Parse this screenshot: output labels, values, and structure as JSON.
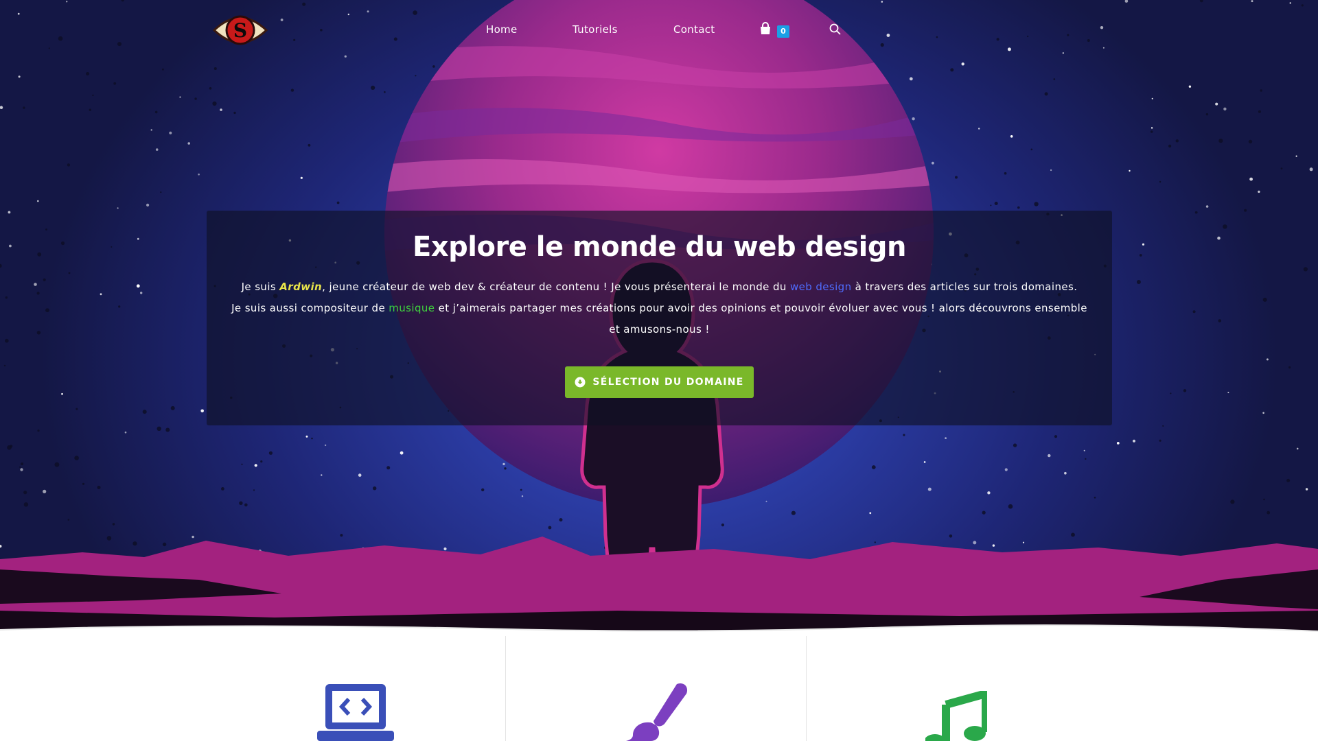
{
  "nav": {
    "items": [
      {
        "label": "Home"
      },
      {
        "label": "Tutoriels"
      },
      {
        "label": "Contact"
      }
    ],
    "cart_count": "0",
    "cart_badge_color": "#1aa0e6",
    "icons": [
      "logo-eye-s",
      "shopping-bag-icon",
      "search-icon"
    ]
  },
  "hero": {
    "title": "Explore le monde du web design",
    "line1": {
      "pre": "Je suis ",
      "name": "Ardwin",
      "mid": ", jeune créateur de web dev & créateur de contenu ! Je vous présenterai le monde du ",
      "link": "web design",
      "post": " à travers des articles sur trois domaines."
    },
    "line2": {
      "pre": "Je suis aussi compositeur de ",
      "link": "musique",
      "post": " et j’aimerais partager mes créations pour avoir des opinions et pouvoir évoluer avec vous ! alors découvrons ensemble et amusons-nous !"
    },
    "cta_label": "SÉLECTION DU DOMAINE",
    "cta_color": "#7ab82a"
  },
  "domains": [
    {
      "icon": "laptop-code-icon",
      "color": "#3a4fb8"
    },
    {
      "icon": "paint-brush-icon",
      "color": "#7c3fc0"
    },
    {
      "icon": "music-note-icon",
      "color": "#2aa84a"
    }
  ],
  "colors": {
    "sky_dark": "#141745",
    "sky_light": "#3a56c8",
    "planet": "#a32c8e",
    "terrain": "#a3227f"
  }
}
